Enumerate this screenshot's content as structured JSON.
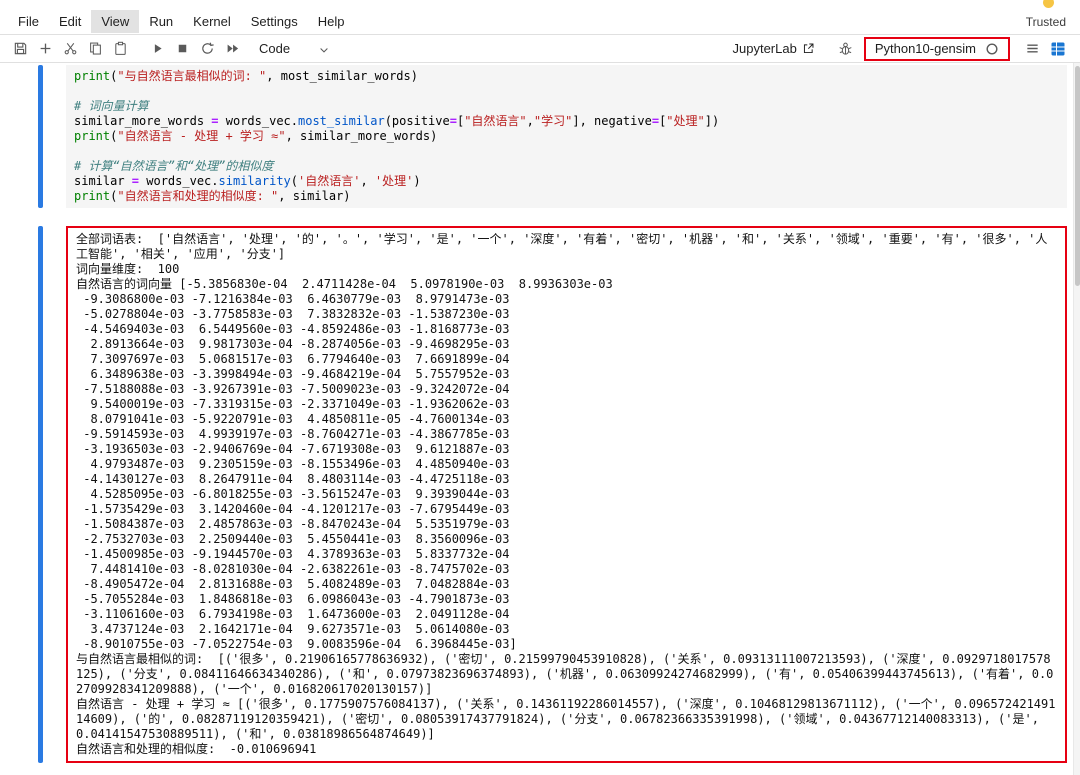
{
  "colors": {
    "annotation": "#e60012",
    "collapser": "#2a7ae2",
    "grid_icon": "#1976d2"
  },
  "menu": {
    "items": [
      {
        "label": "File",
        "active": false
      },
      {
        "label": "Edit",
        "active": false
      },
      {
        "label": "View",
        "active": true
      },
      {
        "label": "Run",
        "active": false
      },
      {
        "label": "Kernel",
        "active": false
      },
      {
        "label": "Settings",
        "active": false
      },
      {
        "label": "Help",
        "active": false
      }
    ],
    "trusted": "Trusted"
  },
  "toolbar": {
    "cell_type": "Code",
    "jupyterlab_label": "JupyterLab",
    "kernel_name": "Python10-gensim"
  },
  "code_cell": {
    "lines": [
      [
        [
          "builtin",
          "print"
        ],
        [
          "plain",
          "("
        ],
        [
          "string",
          "\"与自然语言最相似的词: \""
        ],
        [
          "plain",
          ", most_similar_words)"
        ]
      ],
      [],
      [
        [
          "comment",
          "# 词向量计算"
        ]
      ],
      [
        [
          "plain",
          "similar_more_words "
        ],
        [
          "op",
          "="
        ],
        [
          "plain",
          " words_vec."
        ],
        [
          "property",
          "most_similar"
        ],
        [
          "plain",
          "(positive"
        ],
        [
          "op",
          "="
        ],
        [
          "plain",
          "["
        ],
        [
          "string",
          "\"自然语言\""
        ],
        [
          "plain",
          ","
        ],
        [
          "string",
          "\"学习\""
        ],
        [
          "plain",
          "], negative"
        ],
        [
          "op",
          "="
        ],
        [
          "plain",
          "["
        ],
        [
          "string",
          "\"处理\""
        ],
        [
          "plain",
          "])"
        ]
      ],
      [
        [
          "builtin",
          "print"
        ],
        [
          "plain",
          "("
        ],
        [
          "string",
          "\"自然语言 - 处理 + 学习 ≈\""
        ],
        [
          "plain",
          ", similar_more_words)"
        ]
      ],
      [],
      [
        [
          "comment",
          "# 计算“自然语言”和“处理”的相似度"
        ]
      ],
      [
        [
          "plain",
          "similar "
        ],
        [
          "op",
          "="
        ],
        [
          "plain",
          " words_vec."
        ],
        [
          "property",
          "similarity"
        ],
        [
          "plain",
          "("
        ],
        [
          "string",
          "'自然语言'"
        ],
        [
          "plain",
          ", "
        ],
        [
          "string",
          "'处理'"
        ],
        [
          "plain",
          ")"
        ]
      ],
      [
        [
          "builtin",
          "print"
        ],
        [
          "plain",
          "("
        ],
        [
          "string",
          "\"自然语言和处理的相似度: \""
        ],
        [
          "plain",
          ", similar)"
        ]
      ]
    ]
  },
  "output_cell": {
    "lines": [
      "全部词语表:  ['自然语言', '处理', '的', '。', '学习', '是', '一个', '深度', '有着', '密切', '机器', '和', '关系', '领域', '重要', '有', '很多', '人工智能', '相关', '应用', '分支']",
      "词向量维度:  100",
      "自然语言的词向量 [-5.3856830e-04  2.4711428e-04  5.0978190e-03  8.9936303e-03",
      " -9.3086800e-03 -7.1216384e-03  6.4630779e-03  8.9791473e-03",
      " -5.0278804e-03 -3.7758583e-03  7.3832832e-03 -1.5387230e-03",
      " -4.5469403e-03  6.5449560e-03 -4.8592486e-03 -1.8168773e-03",
      "  2.8913664e-03  9.9817303e-04 -8.2874056e-03 -9.4698295e-03",
      "  7.3097697e-03  5.0681517e-03  6.7794640e-03  7.6691899e-04",
      "  6.3489638e-03 -3.3998494e-03 -9.4684219e-04  5.7557952e-03",
      " -7.5188088e-03 -3.9267391e-03 -7.5009023e-03 -9.3242072e-04",
      "  9.5400019e-03 -7.3319315e-03 -2.3371049e-03 -1.9362062e-03",
      "  8.0791041e-03 -5.9220791e-03  4.4850811e-05 -4.7600134e-03",
      " -9.5914593e-03  4.9939197e-03 -8.7604271e-03 -4.3867785e-03",
      " -3.1936503e-03 -2.9406769e-04 -7.6719308e-03  9.6121887e-03",
      "  4.9793487e-03  9.2305159e-03 -8.1553496e-03  4.4850940e-03",
      " -4.1430127e-03  8.2647911e-04  8.4803114e-03 -4.4725118e-03",
      "  4.5285095e-03 -6.8018255e-03 -3.5615247e-03  9.3939044e-03",
      " -1.5735429e-03  3.1420460e-04 -4.1201217e-03 -7.6795449e-03",
      " -1.5084387e-03  2.4857863e-03 -8.8470243e-04  5.5351979e-03",
      " -2.7532703e-03  2.2509440e-03  5.4550441e-03  8.3560096e-03",
      " -1.4500985e-03 -9.1944570e-03  4.3789363e-03  5.8337732e-04",
      "  7.4481410e-03 -8.0281030e-04 -2.6382261e-03 -8.7475702e-03",
      " -8.4905472e-04  2.8131688e-03  5.4082489e-03  7.0482884e-03",
      " -5.7055284e-03  1.8486818e-03  6.0986043e-03 -4.7901873e-03",
      " -3.1106160e-03  6.7934198e-03  1.6473600e-03  2.0491128e-04",
      "  3.4737124e-03  2.1642171e-04  9.6273571e-03  5.0614080e-03",
      " -8.9010755e-03 -7.0522754e-03  9.0083596e-04  6.3968445e-03]",
      "与自然语言最相似的词:  [('很多', 0.21906165778636932), ('密切', 0.21599790453910828), ('关系', 0.09313111007213593), ('深度', 0.0929718017578125), ('分支', 0.08411646634340286), ('和', 0.07973823696374893), ('机器', 0.06309924274682999), ('有', 0.05406399443745613), ('有着', 0.02709928341209888), ('一个', 0.016820617020130157)]",
      "自然语言 - 处理 + 学习 ≈ [('很多', 0.1775907576084137), ('关系', 0.14361192286014557), ('深度', 0.10468129813671112), ('一个', 0.09657242149114609), ('的', 0.08287119120359421), ('密切', 0.08053917437791824), ('分支', 0.06782366335391998), ('领域', 0.04367712140083313), ('是', 0.04141547530889511), ('和', 0.03818986564874649)]",
      "自然语言和处理的相似度:  -0.010696941"
    ]
  }
}
